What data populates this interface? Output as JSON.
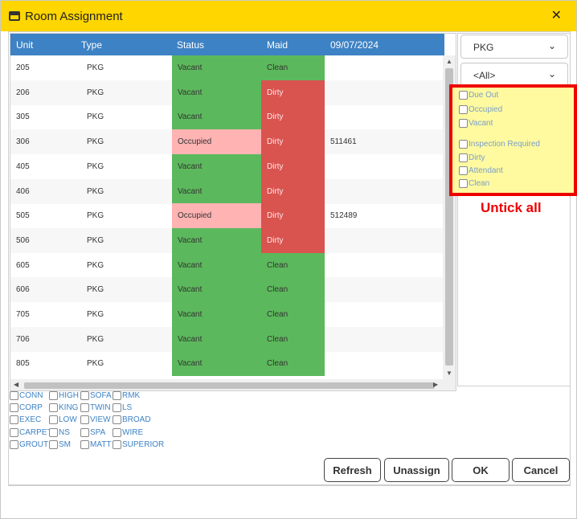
{
  "window": {
    "title": "Room Assignment"
  },
  "grid": {
    "headers": {
      "unit": "Unit",
      "type": "Type",
      "status": "Status",
      "maid": "Maid",
      "date": "09/07/2024"
    },
    "rows": [
      {
        "unit": "205",
        "type": "PKG",
        "status": "Vacant",
        "maid": "Clean",
        "res": ""
      },
      {
        "unit": "206",
        "type": "PKG",
        "status": "Vacant",
        "maid": "Dirty",
        "res": ""
      },
      {
        "unit": "305",
        "type": "PKG",
        "status": "Vacant",
        "maid": "Dirty",
        "res": ""
      },
      {
        "unit": "306",
        "type": "PKG",
        "status": "Occupied",
        "maid": "Dirty",
        "res": "511461"
      },
      {
        "unit": "405",
        "type": "PKG",
        "status": "Vacant",
        "maid": "Dirty",
        "res": ""
      },
      {
        "unit": "406",
        "type": "PKG",
        "status": "Vacant",
        "maid": "Dirty",
        "res": ""
      },
      {
        "unit": "505",
        "type": "PKG",
        "status": "Occupied",
        "maid": "Dirty",
        "res": "512489"
      },
      {
        "unit": "506",
        "type": "PKG",
        "status": "Vacant",
        "maid": "Dirty",
        "res": ""
      },
      {
        "unit": "605",
        "type": "PKG",
        "status": "Vacant",
        "maid": "Clean",
        "res": ""
      },
      {
        "unit": "606",
        "type": "PKG",
        "status": "Vacant",
        "maid": "Clean",
        "res": ""
      },
      {
        "unit": "705",
        "type": "PKG",
        "status": "Vacant",
        "maid": "Clean",
        "res": ""
      },
      {
        "unit": "706",
        "type": "PKG",
        "status": "Vacant",
        "maid": "Clean",
        "res": ""
      },
      {
        "unit": "805",
        "type": "PKG",
        "status": "Vacant",
        "maid": "Clean",
        "res": ""
      }
    ]
  },
  "right_panel": {
    "room_type_value": "PKG",
    "filter_value": "<All>",
    "status_filters": [
      "Due Out",
      "Occupied",
      "Vacant"
    ],
    "housekeeping_filters": [
      "Inspection Required",
      "Dirty",
      "Attendant",
      "Clean"
    ],
    "annotation": "Untick all"
  },
  "feature_tags": [
    [
      "CONN",
      "HIGH",
      "SOFA",
      "RMK"
    ],
    [
      "CORP",
      "KING",
      "TWIN",
      "LS"
    ],
    [
      "EXEC",
      "LOW",
      "VIEW",
      "BROAD"
    ],
    [
      "CARPET",
      "NS",
      "SPA",
      "WIRE"
    ],
    [
      "GROUT",
      "SM",
      "MATT",
      "SUPERIOR"
    ]
  ],
  "buttons": {
    "refresh": "Refresh",
    "unassign": "Unassign",
    "ok": "OK",
    "cancel": "Cancel"
  },
  "colors": {
    "titlebar": "#ffd600",
    "header": "#3d82c4",
    "vacant_clean": "#5cb85c",
    "occupied": "#ffb3b3",
    "dirty": "#d9534f",
    "highlight_border": "#ee0000",
    "highlight_fill": "#fffaa0"
  }
}
